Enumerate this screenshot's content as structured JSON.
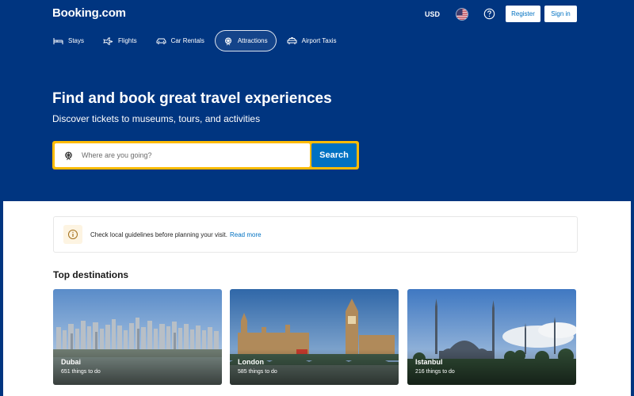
{
  "header": {
    "logo": "Booking.com",
    "currency": "USD",
    "register_label": "Register",
    "signin_label": "Sign in"
  },
  "nav": {
    "items": [
      {
        "label": "Stays",
        "icon": "bed-icon",
        "active": false
      },
      {
        "label": "Flights",
        "icon": "plane-icon",
        "active": false
      },
      {
        "label": "Car Rentals",
        "icon": "car-icon",
        "active": false
      },
      {
        "label": "Attractions",
        "icon": "attractions-icon",
        "active": true
      },
      {
        "label": "Airport Taxis",
        "icon": "taxi-icon",
        "active": false
      }
    ]
  },
  "hero": {
    "title": "Find and book great travel experiences",
    "subtitle": "Discover tickets to museums, tours, and activities"
  },
  "search": {
    "placeholder": "Where are you going?",
    "button_label": "Search"
  },
  "notice": {
    "text": "Check local guidelines before planning your visit.",
    "link": "Read more"
  },
  "destinations": {
    "title": "Top destinations",
    "cards": [
      {
        "name": "Dubai",
        "count": "651 things to do"
      },
      {
        "name": "London",
        "count": "585 things to do"
      },
      {
        "name": "Istanbul",
        "count": "216 things to do"
      }
    ]
  },
  "colors": {
    "brand_blue": "#003580",
    "search_yellow": "#febb02",
    "button_blue": "#0071c2"
  }
}
